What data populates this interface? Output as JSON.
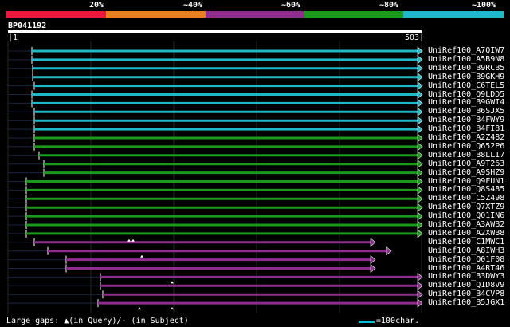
{
  "legend": {
    "segments": [
      {
        "label": "20%",
        "color": "#e8193c"
      },
      {
        "label": "~40%",
        "color": "#e87f1e"
      },
      {
        "label": "~60%",
        "color": "#8e2d8e"
      },
      {
        "label": "~80%",
        "color": "#1a9a1a"
      },
      {
        "label": "~100%",
        "color": "#1fb8c8"
      }
    ]
  },
  "query": {
    "name": "BP041192",
    "start": "1",
    "end": "503"
  },
  "hits": [
    {
      "name": "UniRef100_A7QIW7",
      "color": "#1fb8c8",
      "qs": 40
    },
    {
      "name": "UniRef100_A5B9N8",
      "color": "#1fb8c8",
      "qs": 40
    },
    {
      "name": "UniRef100_B9RCB5",
      "color": "#1fb8c8",
      "qs": 41
    },
    {
      "name": "UniRef100_B9GKH9",
      "color": "#1fb8c8",
      "qs": 41
    },
    {
      "name": "UniRef100_C6TEL5",
      "color": "#1fb8c8",
      "qs": 43
    },
    {
      "name": "UniRef100_Q9LDD5",
      "color": "#1fb8c8",
      "qs": 40
    },
    {
      "name": "UniRef100_B9GWI4",
      "color": "#1fb8c8",
      "qs": 40
    },
    {
      "name": "UniRef100_B6SJX5",
      "color": "#1fb8c8",
      "qs": 43
    },
    {
      "name": "UniRef100_B4FWY9",
      "color": "#1fb8c8",
      "qs": 43
    },
    {
      "name": "UniRef100_B4FI81",
      "color": "#1fb8c8",
      "qs": 43
    },
    {
      "name": "UniRef100_A2Z482",
      "color": "#1a9a1a",
      "qs": 43
    },
    {
      "name": "UniRef100_Q652P6",
      "color": "#1a9a1a",
      "qs": 43
    },
    {
      "name": "UniRef100_B8LLI7",
      "color": "#1a9a1a",
      "qs": 49
    },
    {
      "name": "UniRef100_A9T263",
      "color": "#1a9a1a",
      "qs": 55
    },
    {
      "name": "UniRef100_A9SHZ9",
      "color": "#1a9a1a",
      "qs": 55
    },
    {
      "name": "UniRef100_Q9FUN1",
      "color": "#1a9a1a",
      "qs": 33
    },
    {
      "name": "UniRef100_Q8S485",
      "color": "#1a9a1a",
      "qs": 33
    },
    {
      "name": "UniRef100_C5Z498",
      "color": "#1a9a1a",
      "qs": 33
    },
    {
      "name": "UniRef100_Q7XTZ9",
      "color": "#1a9a1a",
      "qs": 33
    },
    {
      "name": "UniRef100_Q01IN6",
      "color": "#1a9a1a",
      "qs": 33
    },
    {
      "name": "UniRef100_A3AWB2",
      "color": "#1a9a1a",
      "qs": 33
    },
    {
      "name": "UniRef100_A2XWB8",
      "color": "#1a9a1a",
      "qs": 33
    },
    {
      "name": "UniRef100_C1MWC1",
      "color": "#8e2d8e",
      "qs": 43
    },
    {
      "name": "UniRef100_A8IWH3",
      "color": "#8e2d8e",
      "qs": 60
    },
    {
      "name": "UniRef100_Q01F08",
      "color": "#8e2d8e",
      "qs": 83
    },
    {
      "name": "UniRef100_A4RT46",
      "color": "#8e2d8e",
      "qs": 83
    },
    {
      "name": "UniRef100_B3DWY3",
      "color": "#8e2d8e",
      "qs": 126
    },
    {
      "name": "UniRef100_Q1D8V9",
      "color": "#8e2d8e",
      "qs": 126
    },
    {
      "name": "UniRef100_B4CVP8",
      "color": "#8e2d8e",
      "qs": 129
    },
    {
      "name": "UniRef100_B5JGX1",
      "color": "#8e2d8e",
      "qs": 123
    }
  ],
  "footer": {
    "gaps_text": "Large gaps: ▲(in Query)/- (in Subject)",
    "scale_text": "=100char."
  }
}
